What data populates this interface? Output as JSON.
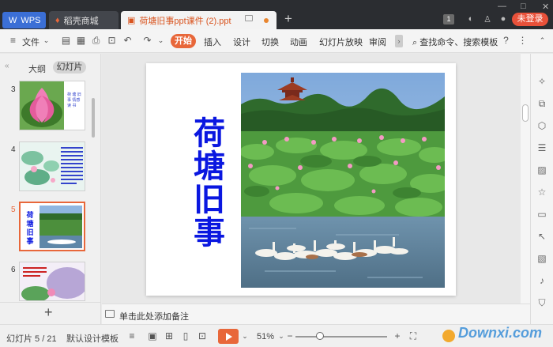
{
  "titlebar": {
    "tabs": [
      {
        "label": "WPS",
        "icon": "wps-logo-icon"
      },
      {
        "label": "稻壳商城",
        "icon": "flame-icon"
      },
      {
        "label": "荷塘旧事ppt课件 (2).ppt",
        "icon": "ppt-file-icon"
      }
    ],
    "badge": "1",
    "login_label": "未登录"
  },
  "menubar": {
    "file_label": "文件",
    "items": [
      "开始",
      "插入",
      "设计",
      "切换",
      "动画",
      "幻灯片放映",
      "审阅"
    ],
    "search_label": "查找命令、搜索模板"
  },
  "leftpanel": {
    "tab_outline": "大纲",
    "tab_slides": "幻灯片",
    "thumbnails": [
      {
        "num": "3",
        "text": "荷 塘 旧 事 情感 读 书"
      },
      {
        "num": "4",
        "text": ""
      },
      {
        "num": "5",
        "text": "荷塘旧事"
      },
      {
        "num": "6",
        "text": ""
      }
    ]
  },
  "slide": {
    "title": "荷塘旧事"
  },
  "notes": {
    "placeholder": "单击此处添加备注"
  },
  "statusbar": {
    "slide_counter": "幻灯片 5 / 21",
    "template": "默认设计模板",
    "zoom": "51%",
    "zoom_fraction": 0.27
  },
  "watermark": "Downxi.com",
  "colors": {
    "accent": "#e8673a",
    "title_blue": "#0a17e0",
    "titlebar_bg": "#2b2d31"
  }
}
